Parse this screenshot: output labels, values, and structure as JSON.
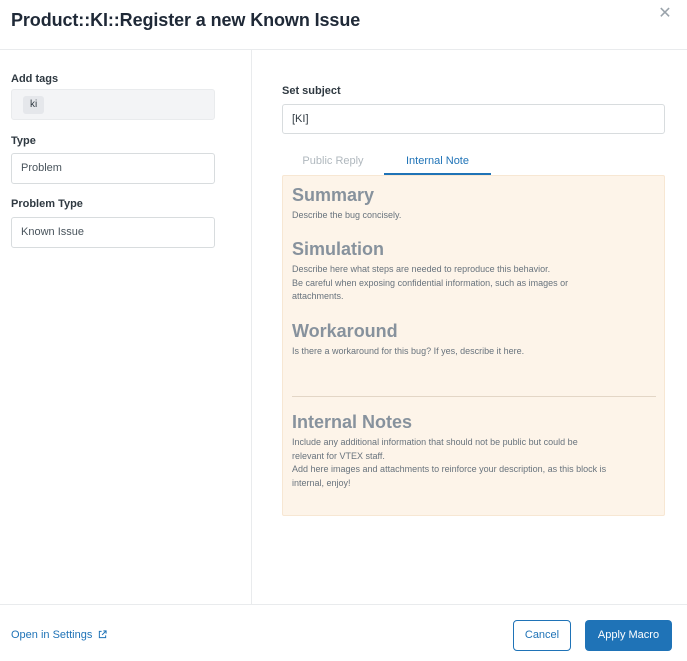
{
  "modal": {
    "title": "Product::KI::Register a new Known Issue",
    "close_icon": "close-icon"
  },
  "left": {
    "tags_label": "Add tags",
    "tags": [
      "ki"
    ],
    "type_label": "Type",
    "type_value": "Problem",
    "problem_type_label": "Problem Type",
    "problem_type_value": "Known Issue"
  },
  "right": {
    "subject_label": "Set subject",
    "subject_value": "[KI]",
    "tabs": [
      {
        "label": "Public Reply",
        "active": false
      },
      {
        "label": "Internal Note",
        "active": true
      }
    ],
    "note": {
      "sections": [
        {
          "title": "Summary",
          "lines": [
            "Describe the bug concisely."
          ]
        },
        {
          "title": "Simulation",
          "lines": [
            "Describe here what steps are needed to reproduce this behavior.",
            "Be careful when exposing confidential information, such as images or",
            "attachments."
          ]
        },
        {
          "title": "Workaround",
          "lines": [
            "Is there a workaround for this bug? If yes, describe it here."
          ]
        },
        {
          "title": "Internal Notes",
          "lines": [
            "Include any additional information that should not be public but could be",
            "relevant for VTEX staff.",
            "Add here images and attachments to reinforce your description, as this block is",
            "internal, enjoy!"
          ]
        }
      ]
    }
  },
  "footer": {
    "settings_link": "Open in Settings",
    "settings_icon": "external-link-icon",
    "cancel_label": "Cancel",
    "apply_label": "Apply Macro"
  },
  "colors": {
    "accent": "#1f73b7",
    "note_background": "#fdf4e9"
  }
}
